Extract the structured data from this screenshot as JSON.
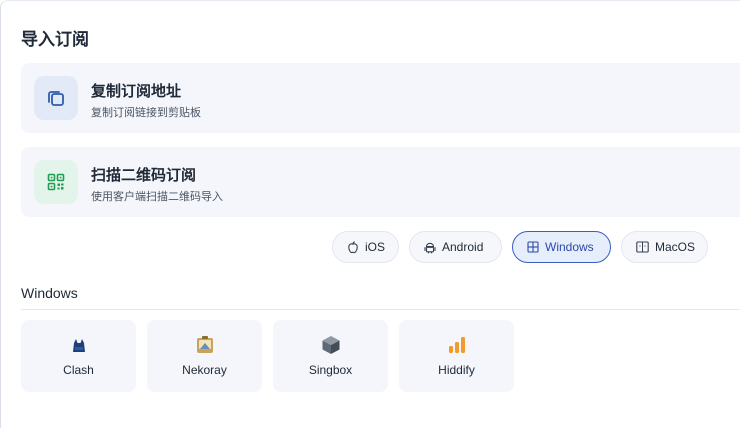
{
  "header": {
    "title": "导入订阅"
  },
  "cards": [
    {
      "title": "复制订阅地址",
      "subtitle": "复制订阅链接到剪贴板",
      "icon": "copy-icon",
      "icon_bg": "#e3eaf7",
      "icon_color": "#2f5db0"
    },
    {
      "title": "扫描二维码订阅",
      "subtitle": "使用客户端扫描二维码导入",
      "icon": "qr-code-icon",
      "icon_bg": "#e3f4ea",
      "icon_color": "#1f9d55"
    }
  ],
  "platform_tabs": [
    {
      "label": "iOS",
      "icon": "apple-icon"
    },
    {
      "label": "Android",
      "icon": "android-icon"
    },
    {
      "label": "Windows",
      "icon": "windows-icon",
      "selected": true
    },
    {
      "label": "MacOS",
      "icon": "macos-icon"
    }
  ],
  "section": {
    "label": "Windows"
  },
  "apps": [
    {
      "label": "Clash",
      "icon": "clash-icon"
    },
    {
      "label": "Nekoray",
      "icon": "nekoray-icon"
    },
    {
      "label": "Singbox",
      "icon": "singbox-icon"
    },
    {
      "label": "Hiddify",
      "icon": "hiddify-icon"
    }
  ],
  "colors": {
    "accent": "#3b5fc0",
    "card_bg": "#f4f6fb",
    "hiddify_orange": "#f39a2b"
  }
}
